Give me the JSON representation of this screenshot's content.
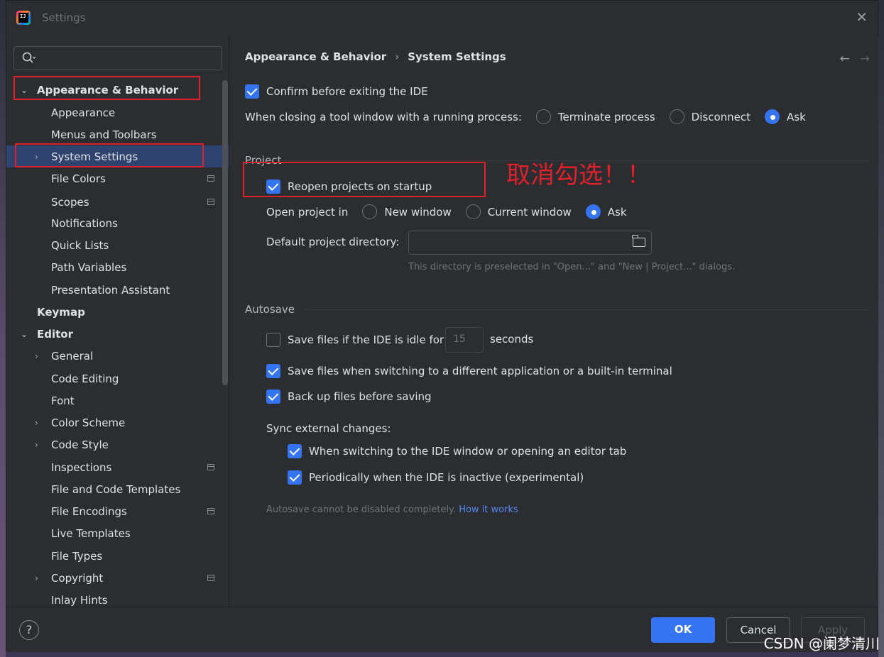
{
  "window": {
    "title": "Settings",
    "close_glyph": "✕",
    "logo_text": "IJ"
  },
  "search": {
    "placeholder": "",
    "icon": "search-icon"
  },
  "sidebar": {
    "items": [
      {
        "label": "Appearance & Behavior",
        "arrow": "⌄",
        "bold": true
      },
      {
        "label": "Appearance"
      },
      {
        "label": "Menus and Toolbars"
      },
      {
        "label": "System Settings",
        "arrow": "›"
      },
      {
        "label": "File Colors",
        "project_icon": true
      },
      {
        "label": "Scopes",
        "project_icon": true
      },
      {
        "label": "Notifications"
      },
      {
        "label": "Quick Lists"
      },
      {
        "label": "Path Variables"
      },
      {
        "label": "Presentation Assistant"
      },
      {
        "label": "Keymap",
        "bold": true
      },
      {
        "label": "Editor",
        "arrow": "⌄",
        "bold": true
      },
      {
        "label": "General",
        "arrow": "›"
      },
      {
        "label": "Code Editing"
      },
      {
        "label": "Font"
      },
      {
        "label": "Color Scheme",
        "arrow": "›"
      },
      {
        "label": "Code Style",
        "arrow": "›"
      },
      {
        "label": "Inspections",
        "project_icon": true
      },
      {
        "label": "File and Code Templates"
      },
      {
        "label": "File Encodings",
        "project_icon": true
      },
      {
        "label": "Live Templates"
      },
      {
        "label": "File Types"
      },
      {
        "label": "Copyright",
        "arrow": "›",
        "project_icon": true
      },
      {
        "label": "Inlay Hints"
      }
    ]
  },
  "breadcrumb": {
    "parent": "Appearance & Behavior",
    "separator": "›",
    "current": "System Settings",
    "back": "←",
    "forward": "→"
  },
  "general": {
    "confirm_exit": {
      "label": "Confirm before exiting the IDE",
      "checked": true
    },
    "closing_tool_window": {
      "label": "When closing a tool window with a running process:",
      "options": [
        "Terminate process",
        "Disconnect",
        "Ask"
      ],
      "selected": "Ask"
    }
  },
  "project": {
    "section_title": "Project",
    "reopen": {
      "label": "Reopen projects on startup",
      "checked": true
    },
    "open_in": {
      "label": "Open project in",
      "options": [
        "New window",
        "Current window",
        "Ask"
      ],
      "selected": "Ask"
    },
    "default_dir": {
      "label": "Default project directory:",
      "value": ""
    },
    "default_dir_hint": "This directory is preselected in \"Open...\" and \"New | Project...\" dialogs."
  },
  "autosave": {
    "section_title": "Autosave",
    "idle": {
      "label": "Save files if the IDE is idle for",
      "value": "15",
      "suffix": "seconds",
      "checked": false
    },
    "switching_app": {
      "label": "Save files when switching to a different application or a built-in terminal",
      "checked": true
    },
    "backup": {
      "label": "Back up files before saving",
      "checked": true
    },
    "sync_label": "Sync external changes:",
    "sync_switch": {
      "label": "When switching to the IDE window or opening an editor tab",
      "checked": true
    },
    "sync_periodic": {
      "label": "Periodically when the IDE is inactive (experimental)",
      "checked": true
    },
    "footnote": "Autosave cannot be disabled completely.",
    "footnote_link": "How it works"
  },
  "annotation": "取消勾选！！",
  "footer": {
    "help": "?",
    "ok": "OK",
    "cancel": "Cancel",
    "apply": "Apply"
  },
  "watermark": "CSDN @阑梦清川",
  "colors": {
    "accent": "#3574f0",
    "annotation_red": "#e0202a",
    "selection": "#2e436e"
  }
}
